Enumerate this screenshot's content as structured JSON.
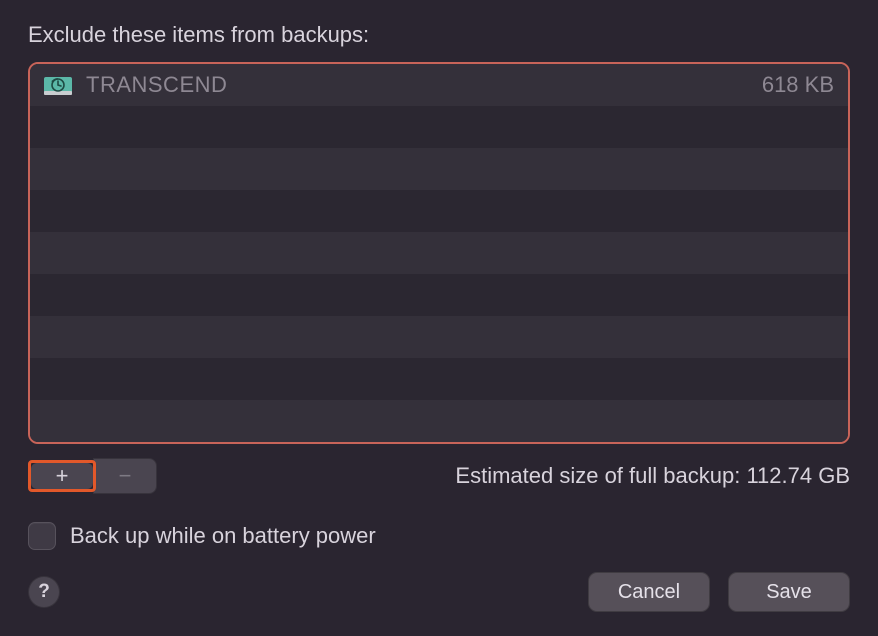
{
  "heading": "Exclude these items from backups:",
  "items": [
    {
      "icon": "time-machine-disk-icon",
      "name": "TRANSCEND",
      "size": "618 KB"
    }
  ],
  "estimate_label": "Estimated size of full backup: ",
  "estimate_value": "112.74 GB",
  "battery_checkbox_label": "Back up while on battery power",
  "add_button_label": "+",
  "remove_button_label": "−",
  "help_label": "?",
  "cancel_label": "Cancel",
  "save_label": "Save"
}
